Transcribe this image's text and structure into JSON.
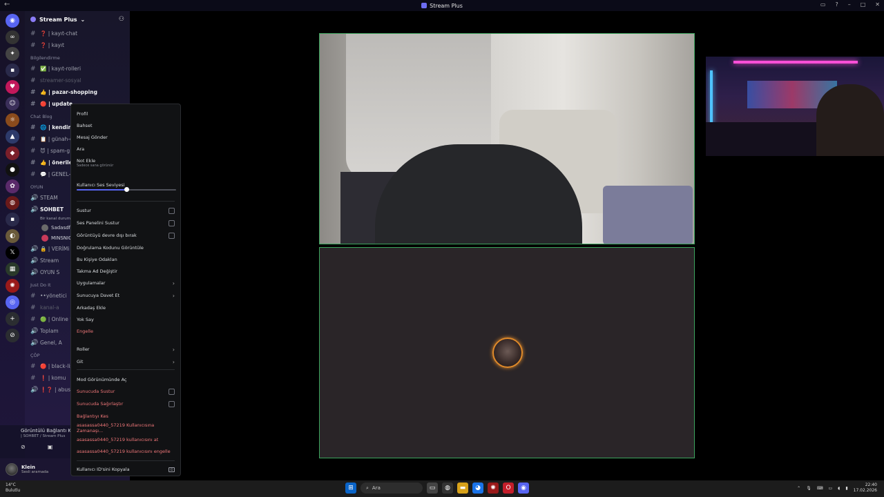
{
  "window": {
    "title": "Stream Plus"
  },
  "guild": {
    "name": "Stream Plus"
  },
  "channels": [
    {
      "type": "text",
      "name": "❓ | kayıt-chat",
      "style": "normal"
    },
    {
      "type": "text",
      "name": "❓ | kayıt",
      "style": "normal"
    },
    {
      "type": "category",
      "name": "Bilgilendirme"
    },
    {
      "type": "text",
      "name": "✅ | kayıt-rolleri",
      "style": "normal"
    },
    {
      "type": "text",
      "name": "streamer-sosyal",
      "style": "dim"
    },
    {
      "type": "text",
      "name": "👍 | pazar-shopping",
      "style": "bright"
    },
    {
      "type": "text",
      "name": "🔴 | update",
      "style": "bright"
    },
    {
      "type": "category",
      "name": "Chat Blog"
    },
    {
      "type": "text",
      "name": "🌐 | kendini-",
      "style": "bright"
    },
    {
      "type": "text",
      "name": "📋 | günah-ç",
      "style": "normal"
    },
    {
      "type": "text",
      "name": "😈 | spam-g",
      "style": "normal"
    },
    {
      "type": "text",
      "name": "👍 | öneriler",
      "style": "bright"
    },
    {
      "type": "text",
      "name": "💬 | GENEL-",
      "style": "normal"
    },
    {
      "type": "category",
      "name": "OYUN"
    },
    {
      "type": "voice",
      "name": "STEAM",
      "style": "normal"
    },
    {
      "type": "voice",
      "name": "SOHBET",
      "style": "bright",
      "status": "Bir kanal durumu"
    },
    {
      "type": "member",
      "name": "Sadasdfa"
    },
    {
      "type": "member",
      "name": "MINSNIC"
    },
    {
      "type": "voice",
      "name": "🔒 | VERİMi",
      "style": "normal"
    },
    {
      "type": "voice",
      "name": "Stream",
      "style": "normal"
    },
    {
      "type": "voice",
      "name": "OYUN S",
      "style": "normal"
    },
    {
      "type": "category",
      "name": "Just Do It"
    },
    {
      "type": "text",
      "name": "••yönetici",
      "style": "normal"
    },
    {
      "type": "text",
      "name": "kanal-a",
      "style": "dim"
    },
    {
      "type": "text",
      "name": "🟢 | Online Ü",
      "style": "normal"
    },
    {
      "type": "voice",
      "name": "Toplam",
      "style": "normal"
    },
    {
      "type": "voice",
      "name": "Genel, A",
      "style": "normal"
    },
    {
      "type": "category",
      "name": "ÇÖP"
    },
    {
      "type": "text",
      "name": "🔴 | black-lis",
      "style": "normal"
    },
    {
      "type": "text",
      "name": "❗ | komu",
      "style": "normal"
    },
    {
      "type": "voice",
      "name": "❗❓ | abus",
      "style": "normal"
    }
  ],
  "voice_panel": {
    "title": "Görüntülü Bağlantı K",
    "subtitle": "| SOHBET / Stream Plus"
  },
  "user": {
    "name": "Klein",
    "status": "Sesli aramada"
  },
  "context_menu": {
    "items": [
      {
        "label": "Profil",
        "kind": "plain",
        "slot": 0
      },
      {
        "label": "Bahset",
        "kind": "plain",
        "slot": 1
      },
      {
        "label": "Mesaj Gönder",
        "kind": "plain",
        "slot": 2
      },
      {
        "label": "Ara",
        "kind": "plain",
        "slot": 3
      },
      {
        "label": "Not Ekle",
        "kind": "plain",
        "slot": 4
      },
      {
        "label": "Kullanıcı Ses Seviyesi",
        "kind": "plain",
        "slot": 5
      },
      {
        "label": "Sustur",
        "kind": "check",
        "slot": 6
      },
      {
        "label": "Ses Panelini Sustur",
        "kind": "check",
        "slot": 7
      },
      {
        "label": "Görüntüyü devre dışı bırak",
        "kind": "check",
        "slot": 8
      },
      {
        "label": "Doğrulama Kodunu Görüntüle",
        "kind": "plain",
        "slot": 9
      },
      {
        "label": "Bu Kişiye Odaklan",
        "kind": "plain",
        "slot": 10
      },
      {
        "label": "Takma Ad Değiştir",
        "kind": "plain",
        "slot": 11
      },
      {
        "label": "Uygulamalar",
        "kind": "submenu",
        "slot": 12
      },
      {
        "label": "Sunucuya Davet Et",
        "kind": "submenu",
        "slot": 13
      },
      {
        "label": "Arkadaş Ekle",
        "kind": "plain",
        "slot": 14
      },
      {
        "label": "Yok Say",
        "kind": "plain",
        "slot": 15
      },
      {
        "label": "Engelle",
        "kind": "danger",
        "slot": 16
      },
      {
        "label": "Roller",
        "kind": "submenu",
        "slot": 17
      },
      {
        "label": "Git",
        "kind": "submenu",
        "slot": 18
      },
      {
        "label": "Mod Görünümünde Aç",
        "kind": "plain",
        "slot": 19
      },
      {
        "label": "Sunucuda Sustur",
        "kind": "danger-check",
        "slot": 20
      },
      {
        "label": "Sunucuda Sağırlaştır",
        "kind": "danger-check",
        "slot": 21
      },
      {
        "label": "Bağlantıyı Kes",
        "kind": "danger",
        "slot": 22
      },
      {
        "label": "asasassa0440_57219 Kullanıcısına Zamanaşı...",
        "kind": "danger",
        "slot": 23
      },
      {
        "label": "asasassa0440_57219 kullanıcısını at",
        "kind": "danger",
        "slot": 24
      },
      {
        "label": "asasassa0440_57219 kullanıcısını engelle",
        "kind": "danger",
        "slot": 25
      },
      {
        "label": "Kullanıcı ID'sini Kopyala",
        "kind": "id",
        "slot": 26
      }
    ],
    "note_hint": "Sadece sana görünür",
    "volume_level": 0.5
  },
  "taskbar": {
    "weather_temp": "14°C",
    "weather_desc": "Bulutlu",
    "search_placeholder": "Ara",
    "time": "22:40",
    "date": "17.02.2026"
  },
  "colors": {
    "accent": "#5865f2",
    "danger": "#f2787a",
    "speaking": "#3ba55d"
  }
}
